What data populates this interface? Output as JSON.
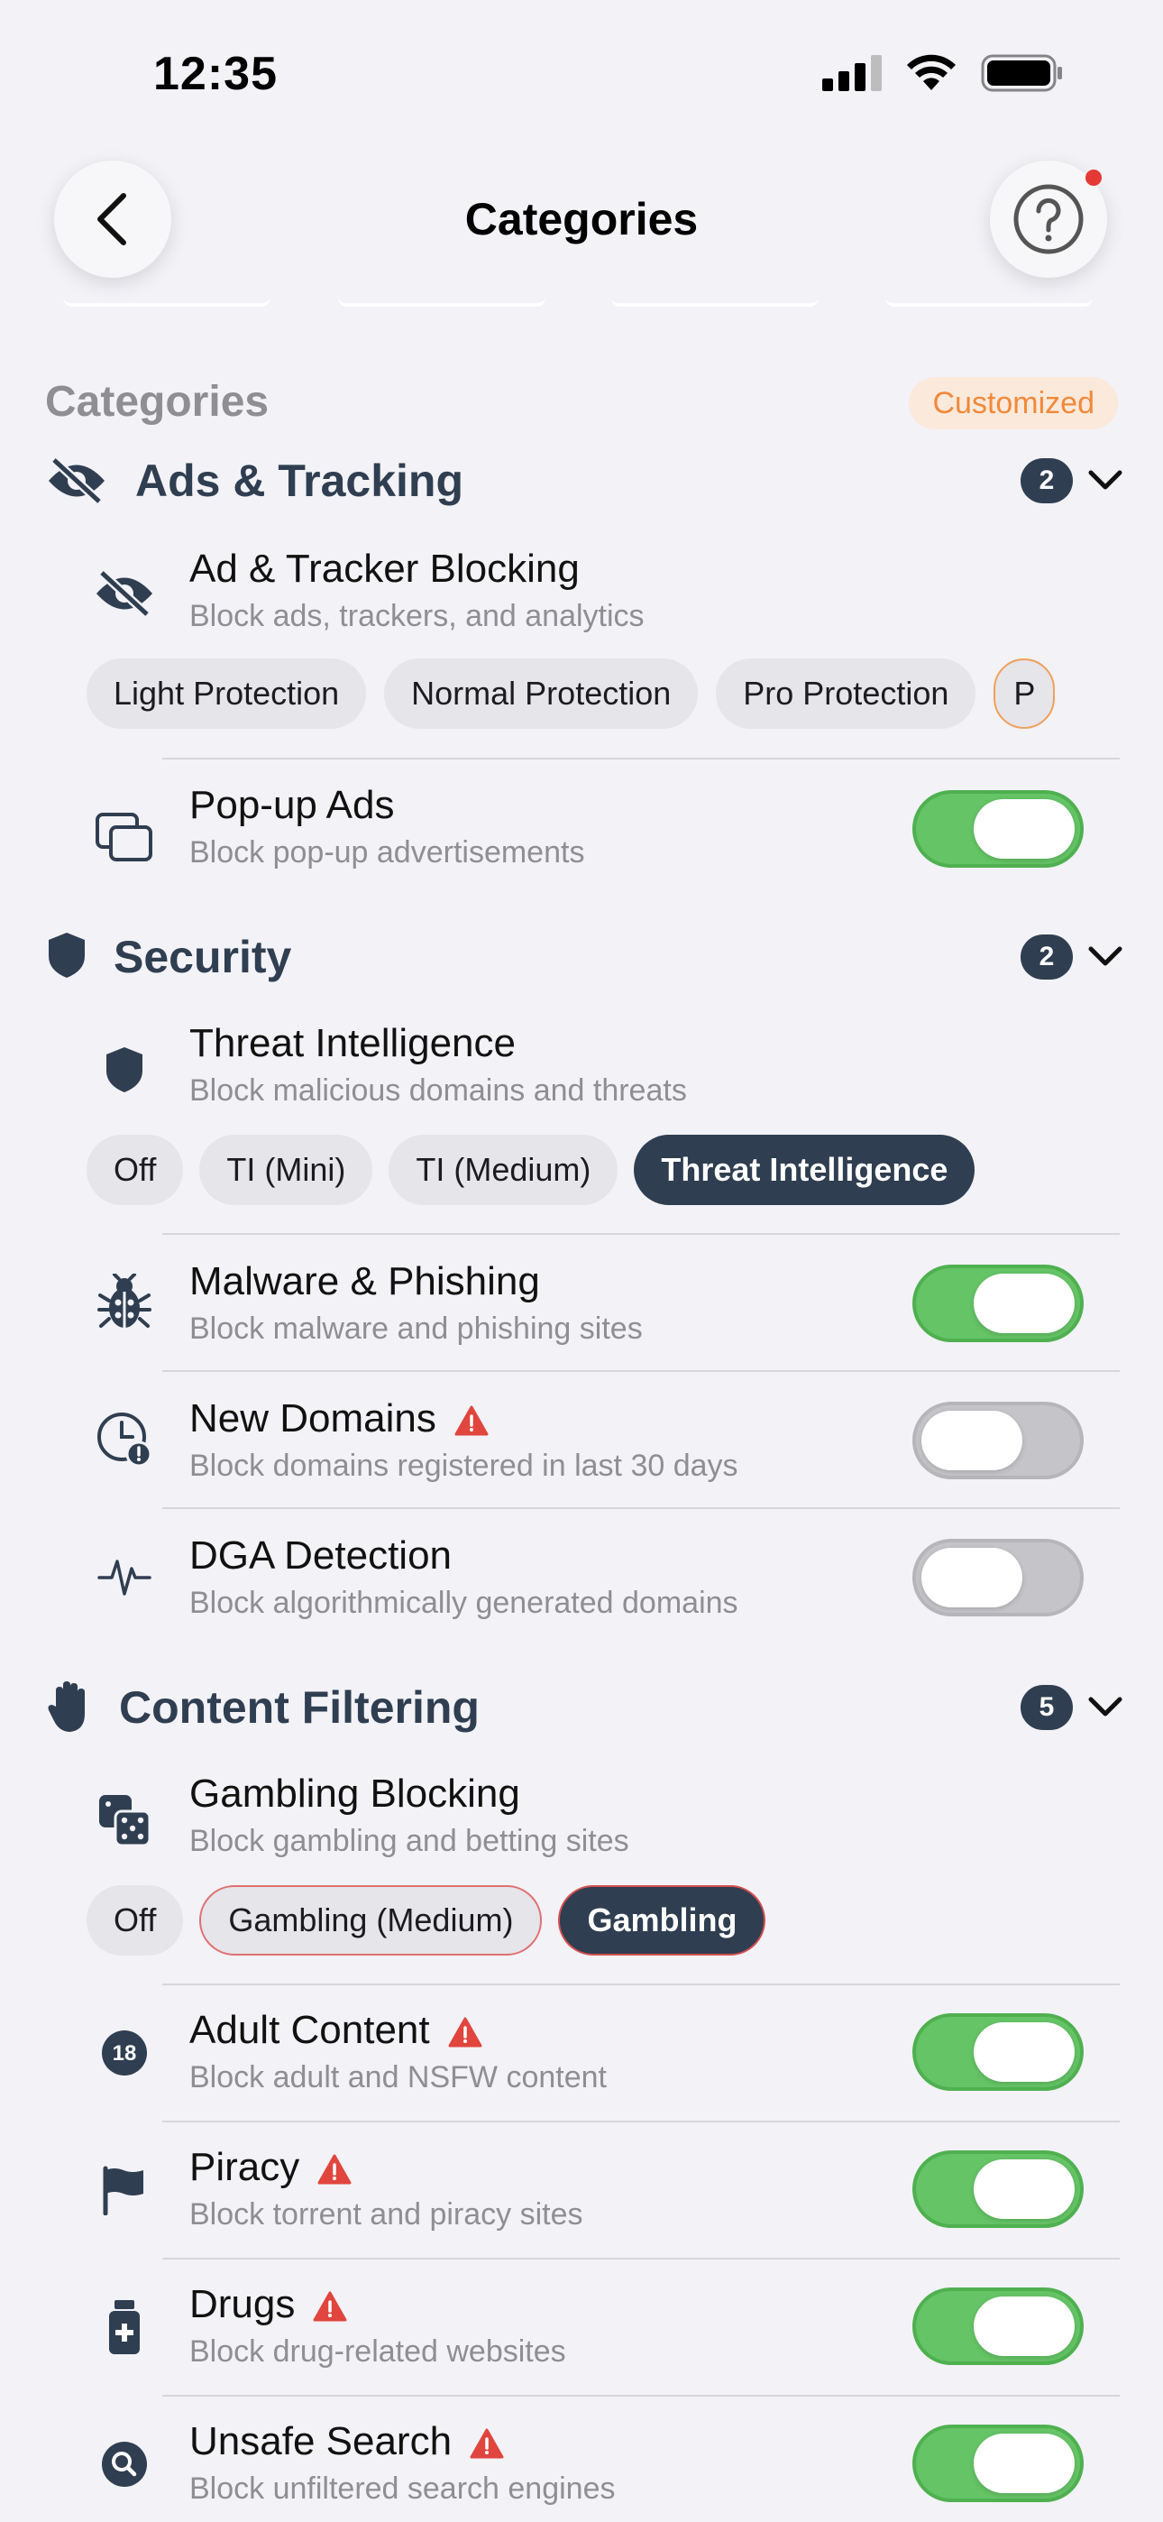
{
  "status": {
    "time": "12:35"
  },
  "nav": {
    "title": "Categories"
  },
  "categories_header": {
    "label": "Categories",
    "tag": "Customized"
  },
  "sections": {
    "ads": {
      "title": "Ads & Tracking",
      "count": "2",
      "blocking": {
        "name": "Ad & Tracker Blocking",
        "desc": "Block ads, trackers, and analytics",
        "chips": [
          "Light Protection",
          "Normal Protection",
          "Pro Protection",
          "P"
        ]
      },
      "popup": {
        "name": "Pop-up Ads",
        "desc": "Block pop-up advertisements",
        "enabled": true
      }
    },
    "security": {
      "title": "Security",
      "count": "2",
      "threat": {
        "name": "Threat Intelligence",
        "desc": "Block malicious domains and threats",
        "chips": [
          "Off",
          "TI (Mini)",
          "TI (Medium)",
          "Threat Intelligence"
        ],
        "selected": "Threat Intelligence"
      },
      "malware": {
        "name": "Malware & Phishing",
        "desc": "Block malware and phishing sites",
        "enabled": true
      },
      "newdomains": {
        "name": "New Domains",
        "desc": "Block domains registered in last 30 days",
        "enabled": false
      },
      "dga": {
        "name": "DGA Detection",
        "desc": "Block algorithmically generated domains",
        "enabled": false
      }
    },
    "content": {
      "title": "Content Filtering",
      "count": "5",
      "gambling": {
        "name": "Gambling Blocking",
        "desc": "Block gambling and betting sites",
        "chips": [
          "Off",
          "Gambling (Medium)",
          "Gambling"
        ],
        "selected": "Gambling"
      },
      "adult": {
        "name": "Adult Content",
        "desc": "Block adult and NSFW content",
        "enabled": true,
        "icon_text": "18"
      },
      "piracy": {
        "name": "Piracy",
        "desc": "Block torrent and piracy sites",
        "enabled": true
      },
      "drugs": {
        "name": "Drugs",
        "desc": "Block drug-related websites",
        "enabled": true
      },
      "unsafe": {
        "name": "Unsafe Search",
        "desc": "Block unfiltered search engines",
        "enabled": true
      }
    }
  },
  "colors": {
    "accent": "#2f3e50",
    "toggle_on": "#65c466",
    "warning": "#e0463e",
    "customized": "#f08a3a"
  }
}
